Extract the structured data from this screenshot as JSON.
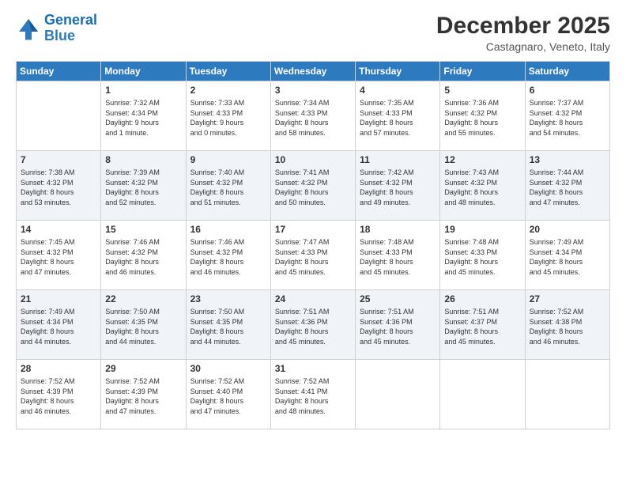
{
  "logo": {
    "line1": "General",
    "line2": "Blue"
  },
  "title": "December 2025",
  "subtitle": "Castagnaro, Veneto, Italy",
  "days_of_week": [
    "Sunday",
    "Monday",
    "Tuesday",
    "Wednesday",
    "Thursday",
    "Friday",
    "Saturday"
  ],
  "weeks": [
    [
      {
        "day": "",
        "info": ""
      },
      {
        "day": "1",
        "info": "Sunrise: 7:32 AM\nSunset: 4:34 PM\nDaylight: 9 hours\nand 1 minute."
      },
      {
        "day": "2",
        "info": "Sunrise: 7:33 AM\nSunset: 4:33 PM\nDaylight: 9 hours\nand 0 minutes."
      },
      {
        "day": "3",
        "info": "Sunrise: 7:34 AM\nSunset: 4:33 PM\nDaylight: 8 hours\nand 58 minutes."
      },
      {
        "day": "4",
        "info": "Sunrise: 7:35 AM\nSunset: 4:33 PM\nDaylight: 8 hours\nand 57 minutes."
      },
      {
        "day": "5",
        "info": "Sunrise: 7:36 AM\nSunset: 4:32 PM\nDaylight: 8 hours\nand 55 minutes."
      },
      {
        "day": "6",
        "info": "Sunrise: 7:37 AM\nSunset: 4:32 PM\nDaylight: 8 hours\nand 54 minutes."
      }
    ],
    [
      {
        "day": "7",
        "info": "Sunrise: 7:38 AM\nSunset: 4:32 PM\nDaylight: 8 hours\nand 53 minutes."
      },
      {
        "day": "8",
        "info": "Sunrise: 7:39 AM\nSunset: 4:32 PM\nDaylight: 8 hours\nand 52 minutes."
      },
      {
        "day": "9",
        "info": "Sunrise: 7:40 AM\nSunset: 4:32 PM\nDaylight: 8 hours\nand 51 minutes."
      },
      {
        "day": "10",
        "info": "Sunrise: 7:41 AM\nSunset: 4:32 PM\nDaylight: 8 hours\nand 50 minutes."
      },
      {
        "day": "11",
        "info": "Sunrise: 7:42 AM\nSunset: 4:32 PM\nDaylight: 8 hours\nand 49 minutes."
      },
      {
        "day": "12",
        "info": "Sunrise: 7:43 AM\nSunset: 4:32 PM\nDaylight: 8 hours\nand 48 minutes."
      },
      {
        "day": "13",
        "info": "Sunrise: 7:44 AM\nSunset: 4:32 PM\nDaylight: 8 hours\nand 47 minutes."
      }
    ],
    [
      {
        "day": "14",
        "info": "Sunrise: 7:45 AM\nSunset: 4:32 PM\nDaylight: 8 hours\nand 47 minutes."
      },
      {
        "day": "15",
        "info": "Sunrise: 7:46 AM\nSunset: 4:32 PM\nDaylight: 8 hours\nand 46 minutes."
      },
      {
        "day": "16",
        "info": "Sunrise: 7:46 AM\nSunset: 4:32 PM\nDaylight: 8 hours\nand 46 minutes."
      },
      {
        "day": "17",
        "info": "Sunrise: 7:47 AM\nSunset: 4:33 PM\nDaylight: 8 hours\nand 45 minutes."
      },
      {
        "day": "18",
        "info": "Sunrise: 7:48 AM\nSunset: 4:33 PM\nDaylight: 8 hours\nand 45 minutes."
      },
      {
        "day": "19",
        "info": "Sunrise: 7:48 AM\nSunset: 4:33 PM\nDaylight: 8 hours\nand 45 minutes."
      },
      {
        "day": "20",
        "info": "Sunrise: 7:49 AM\nSunset: 4:34 PM\nDaylight: 8 hours\nand 45 minutes."
      }
    ],
    [
      {
        "day": "21",
        "info": "Sunrise: 7:49 AM\nSunset: 4:34 PM\nDaylight: 8 hours\nand 44 minutes."
      },
      {
        "day": "22",
        "info": "Sunrise: 7:50 AM\nSunset: 4:35 PM\nDaylight: 8 hours\nand 44 minutes."
      },
      {
        "day": "23",
        "info": "Sunrise: 7:50 AM\nSunset: 4:35 PM\nDaylight: 8 hours\nand 44 minutes."
      },
      {
        "day": "24",
        "info": "Sunrise: 7:51 AM\nSunset: 4:36 PM\nDaylight: 8 hours\nand 45 minutes."
      },
      {
        "day": "25",
        "info": "Sunrise: 7:51 AM\nSunset: 4:36 PM\nDaylight: 8 hours\nand 45 minutes."
      },
      {
        "day": "26",
        "info": "Sunrise: 7:51 AM\nSunset: 4:37 PM\nDaylight: 8 hours\nand 45 minutes."
      },
      {
        "day": "27",
        "info": "Sunrise: 7:52 AM\nSunset: 4:38 PM\nDaylight: 8 hours\nand 46 minutes."
      }
    ],
    [
      {
        "day": "28",
        "info": "Sunrise: 7:52 AM\nSunset: 4:39 PM\nDaylight: 8 hours\nand 46 minutes."
      },
      {
        "day": "29",
        "info": "Sunrise: 7:52 AM\nSunset: 4:39 PM\nDaylight: 8 hours\nand 47 minutes."
      },
      {
        "day": "30",
        "info": "Sunrise: 7:52 AM\nSunset: 4:40 PM\nDaylight: 8 hours\nand 47 minutes."
      },
      {
        "day": "31",
        "info": "Sunrise: 7:52 AM\nSunset: 4:41 PM\nDaylight: 8 hours\nand 48 minutes."
      },
      {
        "day": "",
        "info": ""
      },
      {
        "day": "",
        "info": ""
      },
      {
        "day": "",
        "info": ""
      }
    ]
  ]
}
